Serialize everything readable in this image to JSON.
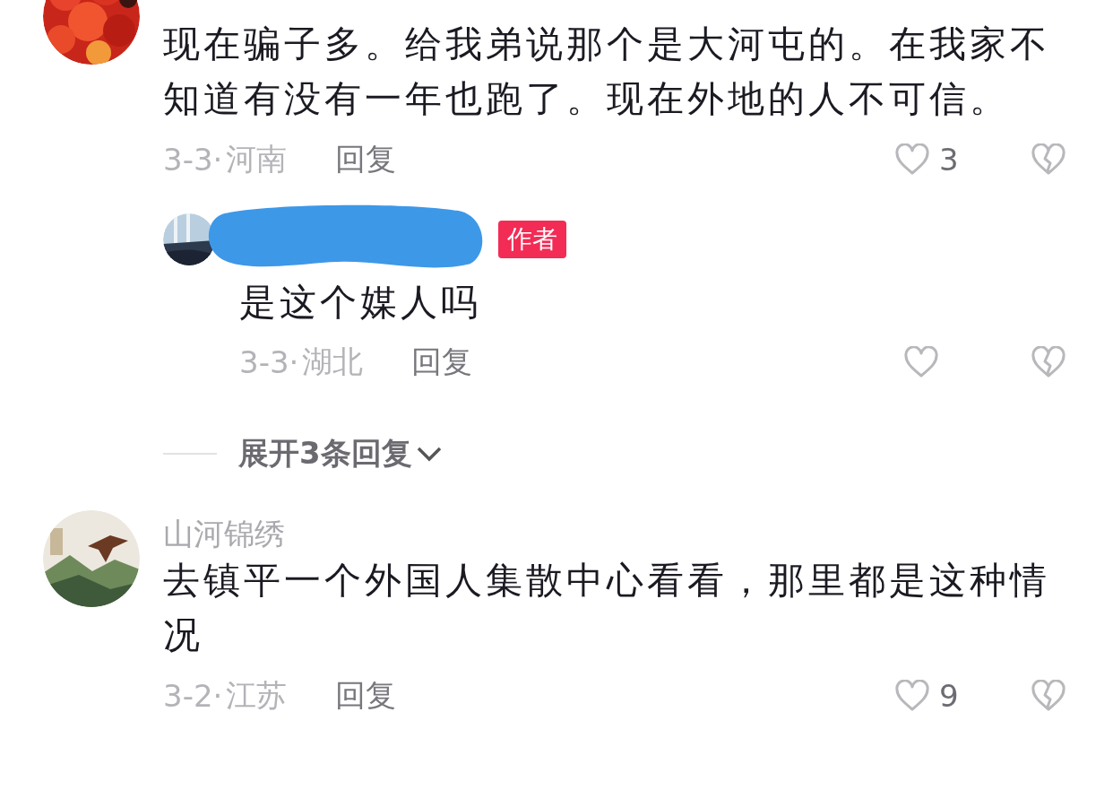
{
  "comments": [
    {
      "text": "现在骗子多。给我弟说那个是大河屯的。在我家不知道有没有一年也跑了。现在外地的人不可信。",
      "date": "3-3·",
      "region": "河南",
      "reply_label": "回复",
      "likes": "3",
      "replies": [
        {
          "name_redacted": true,
          "badge": "作者",
          "text": "是这个媒人吗",
          "date": "3-3·",
          "region": "湖北",
          "reply_label": "回复"
        }
      ],
      "expand_label": "展开3条回复"
    },
    {
      "username": "山河锦绣",
      "text": "去镇平一个外国人集散中心看看，那里都是这种情况",
      "date": "3-2·",
      "region": "江苏",
      "reply_label": "回复",
      "likes": "9"
    }
  ]
}
